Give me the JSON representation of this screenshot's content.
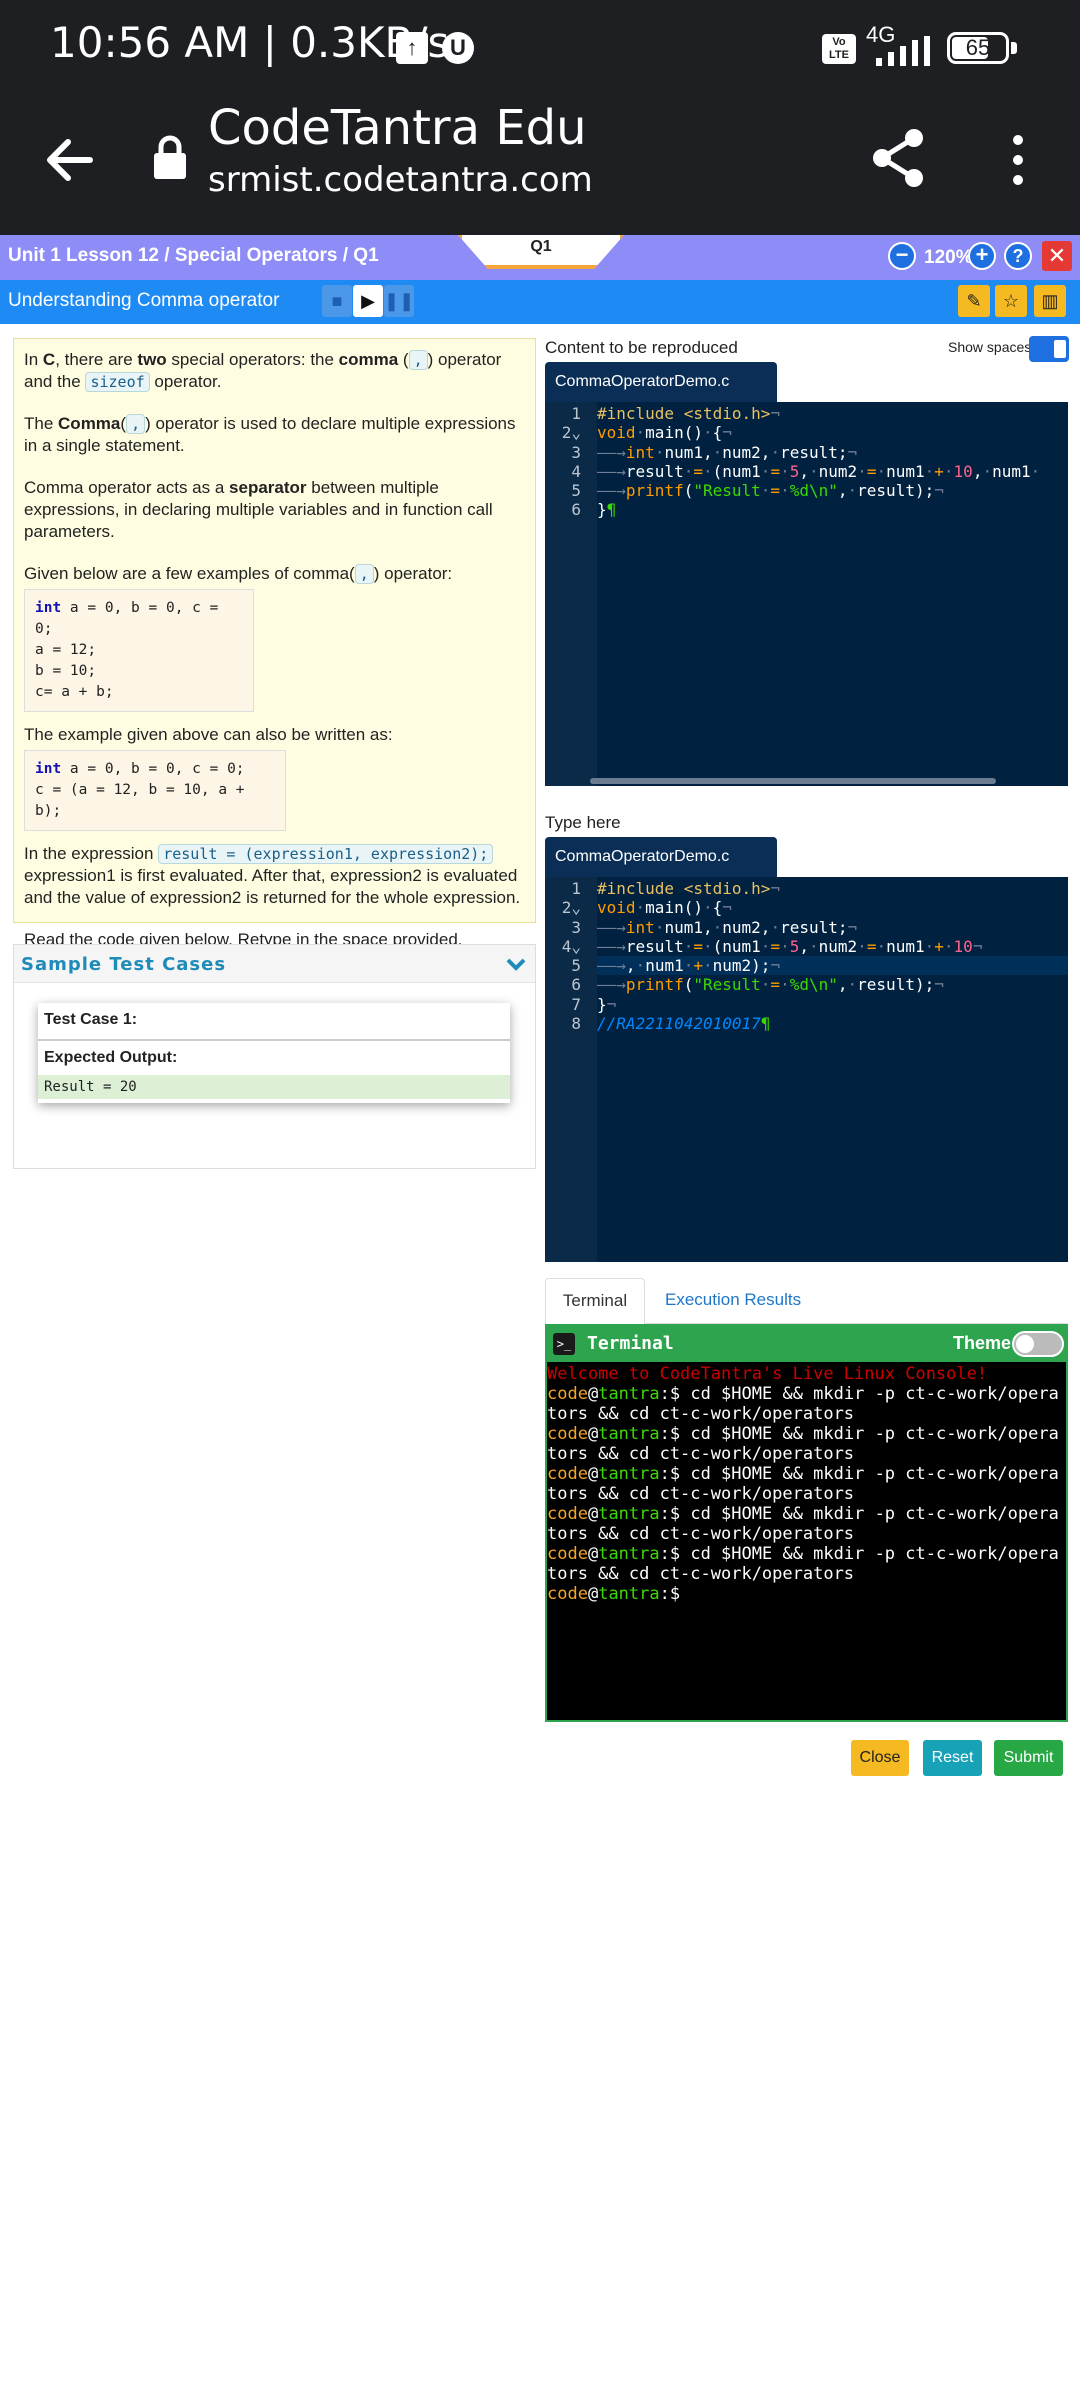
{
  "status_bar": {
    "time_speed": "10:56 AM | 0.3KB/s",
    "volte": "Vo LTE",
    "network": "4G",
    "battery": "65"
  },
  "browser": {
    "site_title": "CodeTantra Edu",
    "url": "srmist.codetantra.com"
  },
  "top_bar": {
    "breadcrumb": "Unit 1 Lesson 12 / Special Operators / Q1",
    "question_tab": "Q1",
    "zoom_out": "−",
    "zoom": "120%",
    "zoom_in": "+",
    "help": "?",
    "close": "✕"
  },
  "lesson_bar": {
    "title": "Understanding Comma operator"
  },
  "description": {
    "p1_a": "In ",
    "p1_c": "C",
    "p1_b": ", there are ",
    "p1_two": "two",
    "p1_d": " special operators: the ",
    "p1_comma": "comma",
    "p1_e": " (",
    "p1_chip": ",",
    "p1_f": ") operator and the ",
    "p1_sizeof": "sizeof",
    "p1_g": " operator.",
    "p2_a": "The ",
    "p2_comma": "Comma",
    "p2_b": "(",
    "p2_chip": ",",
    "p2_c": ") operator is used to declare multiple expressions in a single statement.",
    "p3_a": "Comma operator acts as a ",
    "p3_sep": "separator",
    "p3_b": " between multiple expressions, in declaring multiple variables and in function call parameters.",
    "p4_a": "Given below are a few examples of comma(",
    "p4_chip": ",",
    "p4_b": ") operator:",
    "code1_kw": "int",
    "code1_l1": " a = 0, b = 0, c = 0;",
    "code1_l2": "a = 12;",
    "code1_l3": "b = 10;",
    "code1_l4": "c= a + b;",
    "p5": "The example given above can also be written as:",
    "code2_kw": "int",
    "code2_l1": " a = 0, b = 0, c = 0;",
    "code2_l2": "c = (a = 12, b = 10, a + b);",
    "p6_a": "In the expression ",
    "p6_chip": "result = (expression1, expression2);",
    "p6_b": " expression1 is first evaluated. After that, expression2 is evaluated and the value of expression2 is returned for the whole expression.",
    "p7": "Read the code given below. Retype in the space provided."
  },
  "sample_tests": {
    "title": "Sample Test Cases",
    "case_title": "Test Case 1:",
    "expected_label": "Expected Output:",
    "expected_output": "Result = 20"
  },
  "reference": {
    "label": "Content to be reproduced",
    "show_spaces": "Show spaces",
    "filename": "CommaOperatorDemo.c"
  },
  "typing": {
    "label": "Type here",
    "filename": "CommaOperatorDemo.c",
    "comment": "//RA2211042010017"
  },
  "output_tabs": {
    "terminal": "Terminal",
    "execution": "Execution Results"
  },
  "terminal": {
    "title": "Terminal",
    "theme": "Theme",
    "welcome": "Welcome to CodeTantra's Live Linux Console!",
    "user": "code",
    "at": "@",
    "host": "tantra",
    "prompt": ":$ ",
    "command": "cd $HOME && mkdir -p ct-c-work/operators && cd ct-c-work/operators"
  },
  "actions": {
    "close": "Close",
    "reset": "Reset",
    "submit": "Submit"
  },
  "colors": {
    "purple_bar": "#8e8cf7",
    "blue_bar": "#1e8bf4",
    "editor_bg": "#002240",
    "terminal_green": "#2ea44f",
    "close_btn": "#f5b921",
    "reset_btn": "#17a2b8",
    "submit_btn": "#28a745"
  }
}
